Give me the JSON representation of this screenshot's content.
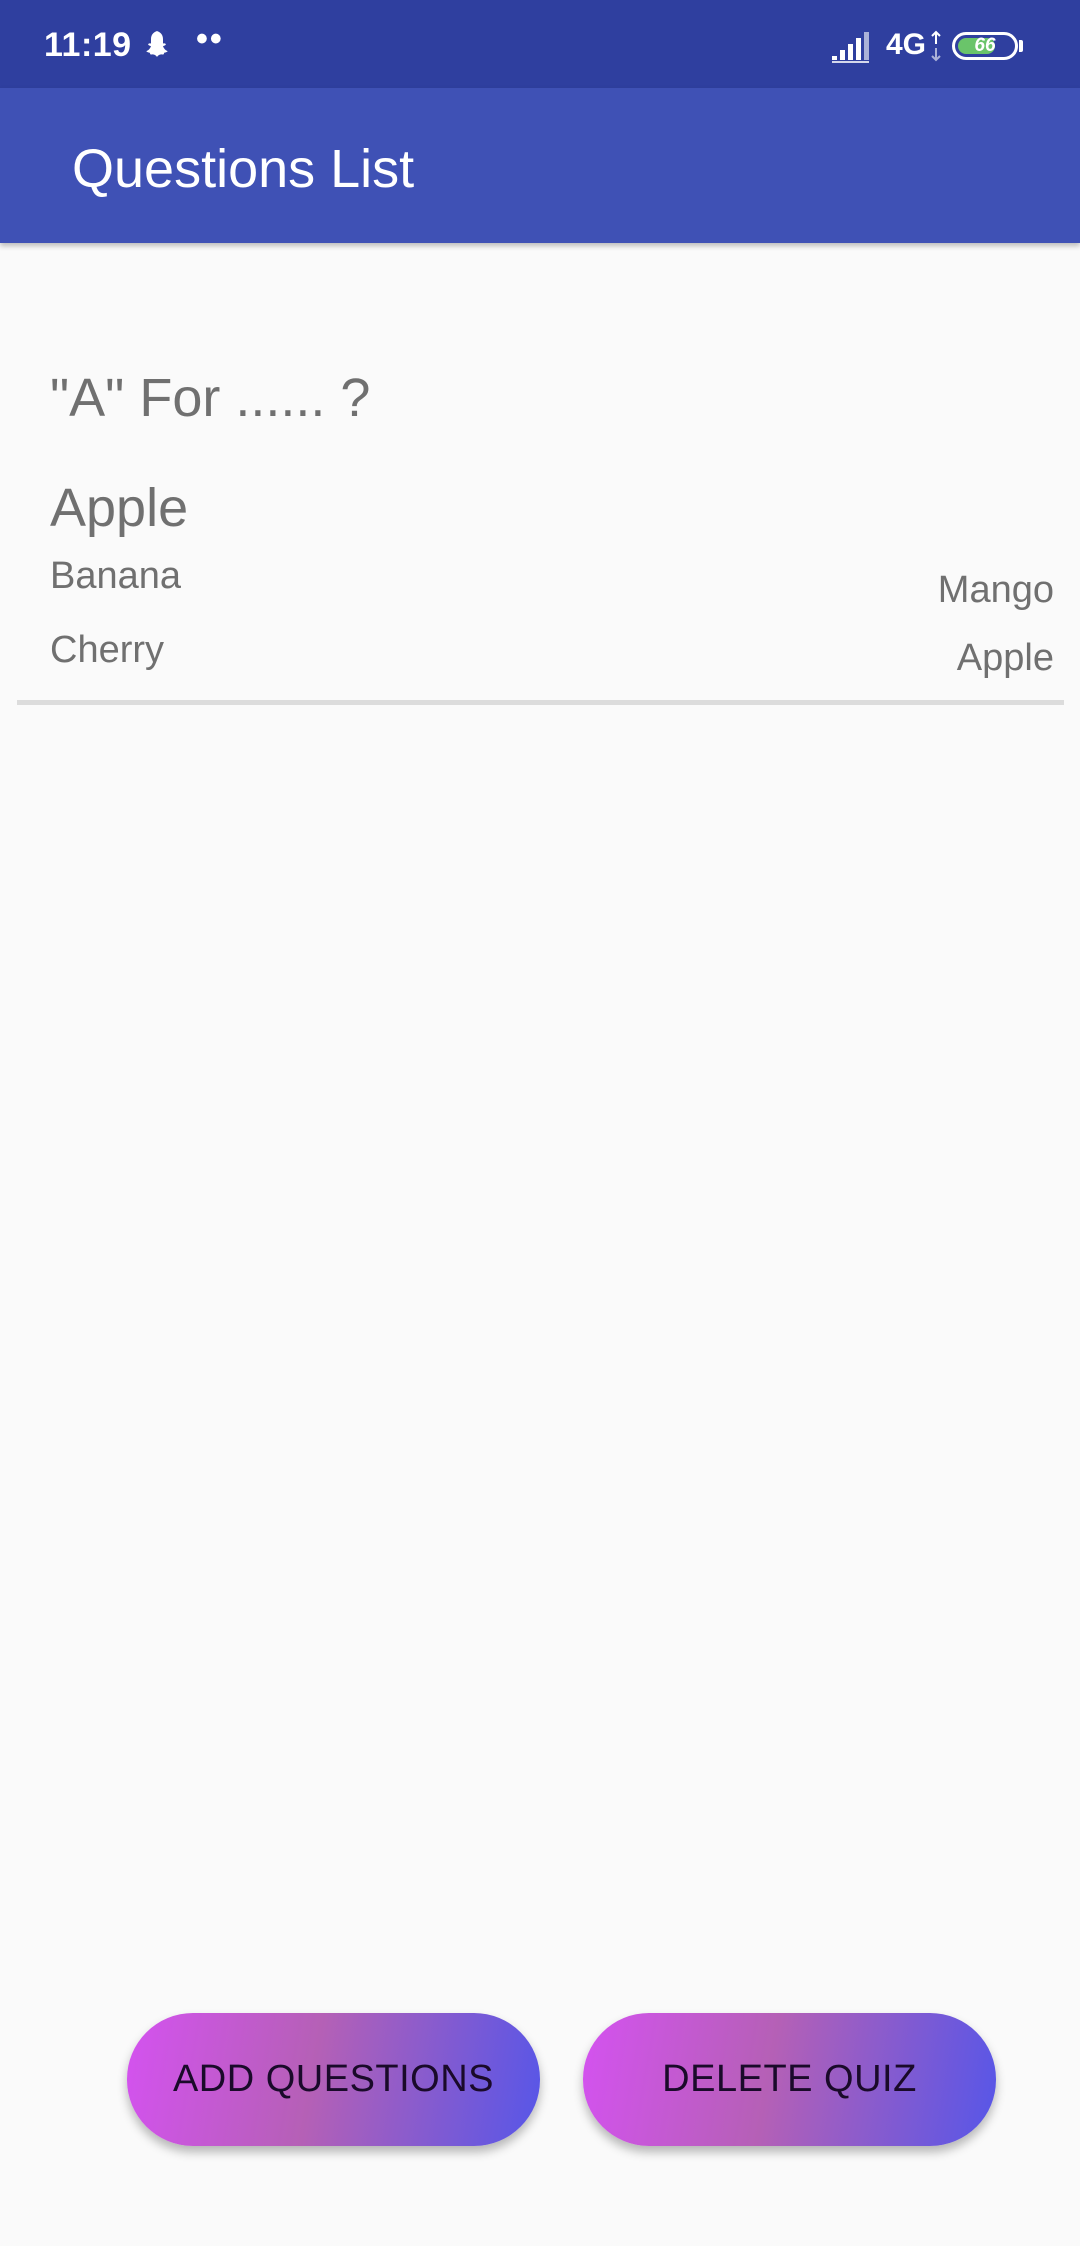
{
  "status_bar": {
    "time": "11:19",
    "dots": "••",
    "network": "4G",
    "battery_level": "66",
    "icons": [
      "snapchat-icon",
      "signal-icon",
      "network-arrows-icon",
      "battery-icon"
    ]
  },
  "app_bar": {
    "title": "Questions List"
  },
  "questions": [
    {
      "question": "\"A\" For ...... ?",
      "answer": "Apple",
      "options": [
        "Banana",
        "Cherry",
        "Mango",
        "Apple"
      ]
    }
  ],
  "buttons": {
    "add_label": "ADD QUESTIONS",
    "delete_label": "DELETE QUIZ"
  },
  "colors": {
    "status_bar": "#2f3f9f",
    "app_bar": "#3f51b5",
    "background": "#fafafa",
    "text_gray": "#707070",
    "button_gradient_start": "#d452f0",
    "button_gradient_end": "#5656e8",
    "battery_fill": "#6ac46a"
  }
}
